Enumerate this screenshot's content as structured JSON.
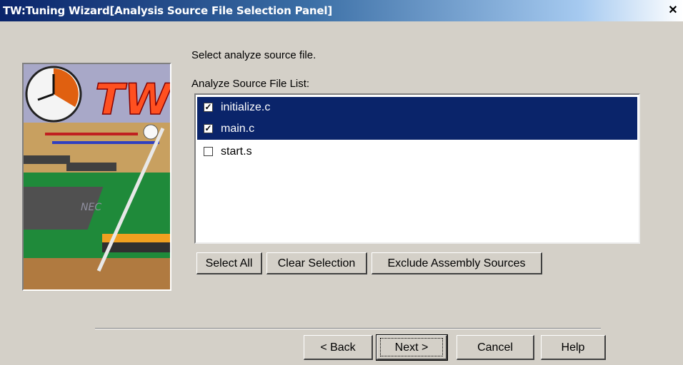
{
  "window": {
    "title": "TW:Tuning Wizard[Analysis Source File Selection Panel]",
    "close_glyph": "✕"
  },
  "panel": {
    "instruction": "Select analyze source file.",
    "list_label": "Analyze Source File List:",
    "files": [
      {
        "name": "initialize.c",
        "checked": true,
        "selected": true
      },
      {
        "name": "main.c",
        "checked": true,
        "selected": true
      },
      {
        "name": "start.s",
        "checked": false,
        "selected": false
      }
    ],
    "buttons": {
      "select_all": "Select All",
      "clear_selection": "Clear Selection",
      "exclude_assembly": "Exclude Assembly Sources"
    },
    "image_logo_text": "TW",
    "image_chip_text": "NEC"
  },
  "footer": {
    "back": "< Back",
    "next": "Next >",
    "cancel": "Cancel",
    "help": "Help"
  }
}
